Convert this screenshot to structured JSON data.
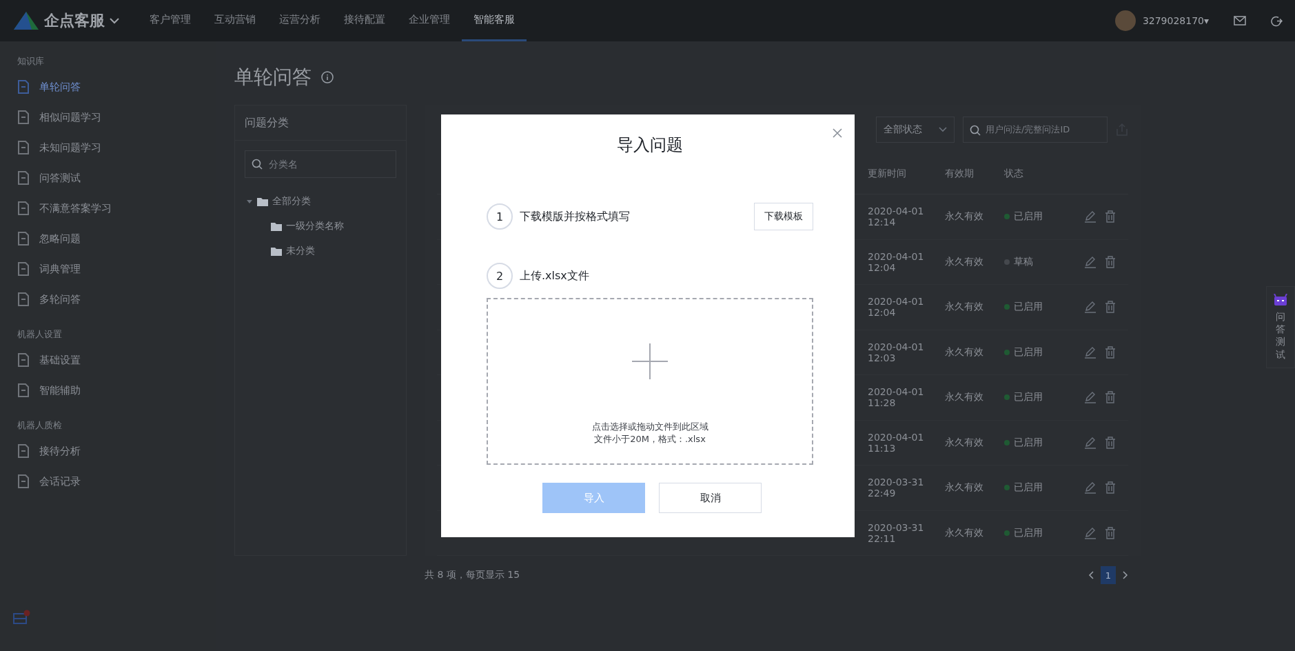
{
  "topbar": {
    "logo": "企点客服",
    "nav": [
      {
        "label": "客户管理",
        "selected": false
      },
      {
        "label": "互动营销",
        "selected": false
      },
      {
        "label": "运营分析",
        "selected": false
      },
      {
        "label": "接待配置",
        "selected": false
      },
      {
        "label": "企业管理",
        "selected": false
      },
      {
        "label": "智能客服",
        "selected": true
      }
    ],
    "account": "3279028170▾"
  },
  "sidebar": {
    "groups": [
      {
        "title": "知识库",
        "items": [
          {
            "label": "单轮问答",
            "selected": true
          },
          {
            "label": "相似问题学习",
            "selected": false
          },
          {
            "label": "未知问题学习",
            "selected": false
          },
          {
            "label": "问答测试",
            "selected": false
          },
          {
            "label": "不满意答案学习",
            "selected": false
          },
          {
            "label": "忽略问题",
            "selected": false
          },
          {
            "label": "词典管理",
            "selected": false
          },
          {
            "label": "多轮问答",
            "selected": false
          }
        ]
      },
      {
        "title": "机器人设置",
        "items": [
          {
            "label": "基础设置",
            "selected": false
          },
          {
            "label": "智能辅助",
            "selected": false
          }
        ]
      },
      {
        "title": "机器人质检",
        "items": [
          {
            "label": "接待分析",
            "selected": false
          },
          {
            "label": "会话记录",
            "selected": false
          }
        ]
      }
    ]
  },
  "page": {
    "title": "单轮问答",
    "category_panel": {
      "title": "问题分类",
      "search_placeholder": "分类名",
      "tree": [
        {
          "label": "全部分类",
          "expanded": true,
          "children": [
            {
              "label": "一级分类名称"
            },
            {
              "label": "未分类"
            }
          ]
        }
      ]
    },
    "filters": {
      "status": "全部状态",
      "search_placeholder": "用户问法/完整问法ID"
    },
    "table": {
      "columns": [
        "更新时间",
        "有效期",
        "状态"
      ],
      "rows": [
        {
          "date": "2020-04-01",
          "time": "12:14",
          "validity": "永久有效",
          "status": "已启用",
          "color": "#1f5a33"
        },
        {
          "date": "2020-04-01",
          "time": "12:04",
          "validity": "永久有效",
          "status": "草稿",
          "color": "#45484d"
        },
        {
          "date": "2020-04-01",
          "time": "12:04",
          "validity": "永久有效",
          "status": "已启用",
          "color": "#1f5a33"
        },
        {
          "date": "2020-04-01",
          "time": "12:03",
          "validity": "永久有效",
          "status": "已启用",
          "color": "#1f5a33"
        },
        {
          "date": "2020-04-01",
          "time": "11:28",
          "validity": "永久有效",
          "status": "已启用",
          "color": "#1f5a33"
        },
        {
          "date": "2020-04-01",
          "time": "11:13",
          "validity": "永久有效",
          "status": "已启用",
          "color": "#1f5a33"
        },
        {
          "date": "2020-03-31",
          "time": "22:49",
          "validity": "永久有效",
          "status": "已启用",
          "color": "#1f5a33"
        },
        {
          "date": "2020-03-31",
          "time": "22:11",
          "validity": "永久有效",
          "status": "已启用",
          "color": "#1f5a33"
        }
      ]
    },
    "pagination": {
      "summary": "共 8 项，每页显示 15",
      "pages": [
        {
          "label": "1",
          "selected": true
        }
      ]
    },
    "side_tab": {
      "label": "问答测试"
    }
  },
  "dialog": {
    "title": "导入问题",
    "steps": [
      {
        "number": "1",
        "text": "下载模版并按格式填写",
        "action": "下载模板"
      },
      {
        "number": "2",
        "text": "上传.xlsx文件"
      }
    ],
    "dropzone": {
      "hint": "点击选择或拖动文件到此区域",
      "note": "文件小于20M，格式：.xlsx"
    },
    "buttons": [
      {
        "label": "导入",
        "kind": "primary",
        "disabled": true
      },
      {
        "label": "取消",
        "kind": "default",
        "disabled": false
      }
    ]
  }
}
